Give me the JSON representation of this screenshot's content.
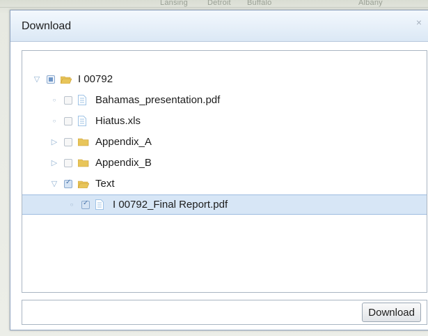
{
  "background_map": {
    "labels": [
      "Lansing",
      "Detroit",
      "Buffalo",
      "Albany"
    ]
  },
  "dialog": {
    "title": "Download",
    "close_glyph": "×",
    "tree": [
      {
        "label": "I 00792",
        "type": "folder-open",
        "toggle": "expanded",
        "check": "partial",
        "selected": false
      },
      {
        "label": "Bahamas_presentation.pdf",
        "type": "file",
        "toggle": "leaf",
        "check": "unchecked",
        "selected": false
      },
      {
        "label": "Hiatus.xls",
        "type": "file",
        "toggle": "leaf",
        "check": "unchecked",
        "selected": false
      },
      {
        "label": "Appendix_A",
        "type": "folder",
        "toggle": "collapsed",
        "check": "unchecked",
        "selected": false
      },
      {
        "label": "Appendix_B",
        "type": "folder",
        "toggle": "collapsed",
        "check": "unchecked",
        "selected": false
      },
      {
        "label": "Text",
        "type": "folder-open",
        "toggle": "expanded",
        "check": "checked",
        "selected": false
      },
      {
        "label": "I 00792_Final Report.pdf",
        "type": "file",
        "toggle": "leaf",
        "check": "checked",
        "selected": true
      }
    ],
    "download_label": "Download"
  },
  "colors": {
    "header_gradient_top": "#f3f8fd",
    "header_gradient_bottom": "#dbe8f5",
    "selected_row": "#d7e6f6",
    "folder": "#e8c55a",
    "file": "#9fc3e6"
  }
}
